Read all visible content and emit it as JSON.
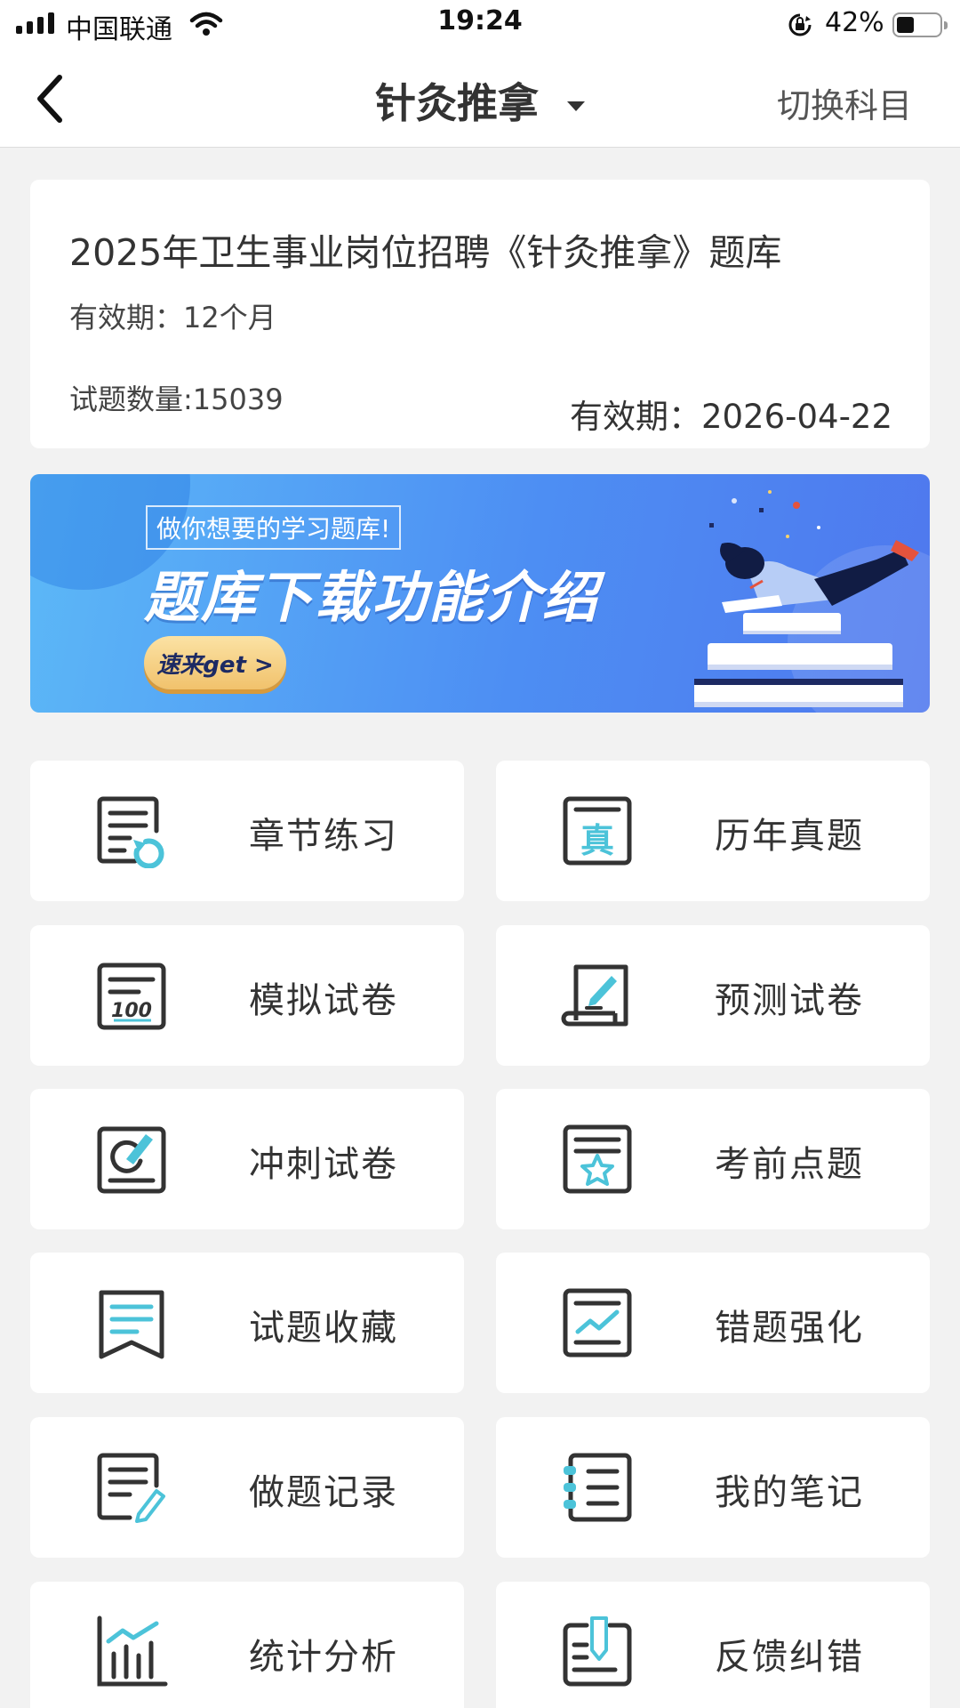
{
  "status_bar": {
    "carrier": "中国联通",
    "time": "19:24",
    "battery": "42%",
    "battery_level": 0.42
  },
  "nav": {
    "title": "针灸推拿",
    "switch_label": "切换科目"
  },
  "info": {
    "title": "2025年卫生事业岗位招聘《针灸推拿》题库",
    "validity": "有效期：12个月",
    "count": "试题数量:15039",
    "expire": "有效期：2026-04-22"
  },
  "banner": {
    "tag": "做你想要的学习题库!",
    "headline": "题库下载功能介绍",
    "cta": "速来get >"
  },
  "menu": [
    {
      "label": "章节练习",
      "icon": "chapter-practice-icon"
    },
    {
      "label": "历年真题",
      "icon": "past-papers-icon"
    },
    {
      "label": "模拟试卷",
      "icon": "mock-exam-icon"
    },
    {
      "label": "预测试卷",
      "icon": "forecast-exam-icon"
    },
    {
      "label": "冲刺试卷",
      "icon": "sprint-exam-icon"
    },
    {
      "label": "考前点题",
      "icon": "key-questions-icon"
    },
    {
      "label": "试题收藏",
      "icon": "bookmark-icon"
    },
    {
      "label": "错题强化",
      "icon": "wrong-questions-icon"
    },
    {
      "label": "做题记录",
      "icon": "records-icon"
    },
    {
      "label": "我的笔记",
      "icon": "notes-icon"
    },
    {
      "label": "统计分析",
      "icon": "statistics-icon"
    },
    {
      "label": "反馈纠错",
      "icon": "feedback-icon"
    }
  ],
  "colors": {
    "accent": "#4cc3d9",
    "icon_stroke": "#333333",
    "background": "#f2f2f2"
  }
}
